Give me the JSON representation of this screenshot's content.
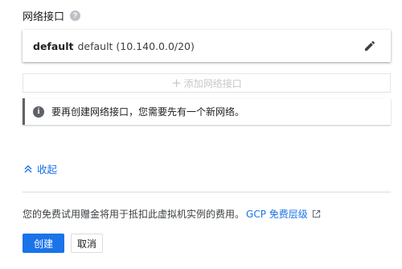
{
  "network_interfaces": {
    "title": "网络接口",
    "help_icon": "help-circle-icon",
    "items": [
      {
        "name": "default",
        "detail": "default (10.140.0.0/20)",
        "edit_icon": "pencil-icon"
      }
    ],
    "add_button": {
      "icon": "plus-icon",
      "label": "添加网络接口",
      "disabled": true
    },
    "info_message": {
      "icon": "info-icon",
      "text": "要再创建网络接口，您需要先有一个新网络。"
    }
  },
  "collapse": {
    "icon": "double-chevron-up-icon",
    "label": "收起"
  },
  "footer": {
    "note": "您的免费试用赠金将用于抵扣此虚拟机实例的费用。",
    "link_label": "GCP 免费层级",
    "link_icon": "external-link-icon"
  },
  "actions": {
    "create_label": "创建",
    "cancel_label": "取消"
  },
  "colors": {
    "accent": "#1a73e8",
    "text": "#202124",
    "muted": "#5f6368",
    "disabled": "#c5c7ca"
  }
}
